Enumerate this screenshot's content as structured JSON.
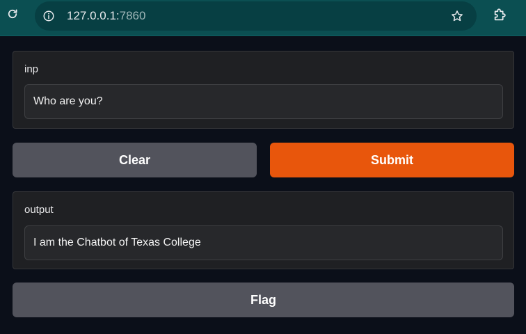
{
  "browser": {
    "url_host": "127.0.0.1:",
    "url_port": "7860",
    "icons": {
      "reload": "reload-icon",
      "info": "info-icon",
      "star": "star-icon",
      "extensions": "puzzle-icon"
    },
    "colors": {
      "toolbar": "#0b4f52",
      "omnibox": "#073f43"
    }
  },
  "form": {
    "input_label": "inp",
    "input_value": "Who are you?",
    "clear_label": "Clear",
    "submit_label": "Submit",
    "output_label": "output",
    "output_value": "I am the Chatbot of Texas College",
    "flag_label": "Flag"
  },
  "colors": {
    "primary": "#e8560c",
    "secondary": "#52535c",
    "panel": "#1f2023",
    "background": "#0b0f19"
  }
}
